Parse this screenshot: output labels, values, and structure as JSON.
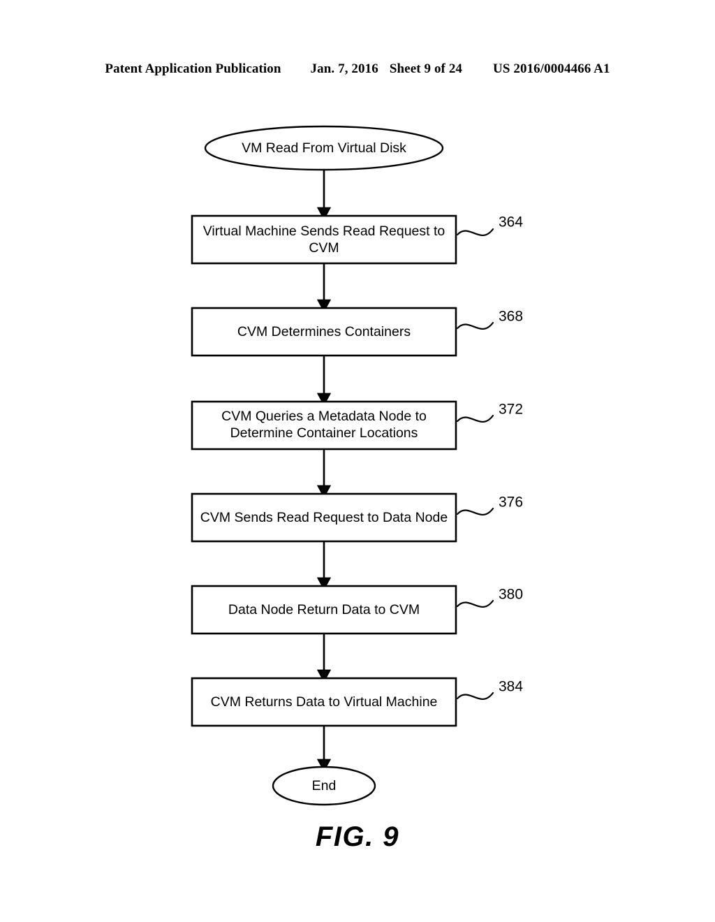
{
  "header": {
    "publication": "Patent Application Publication",
    "date": "Jan. 7, 2016",
    "sheet": "Sheet 9 of 24",
    "patent_number": "US 2016/0004466 A1"
  },
  "figure": {
    "caption": "FIG. 9",
    "start_node": "VM Read From Virtual Disk",
    "end_node": "End"
  },
  "flow": {
    "steps": [
      {
        "ref": "364",
        "line1": "Virtual Machine Sends Read Request to",
        "line2": "CVM"
      },
      {
        "ref": "368",
        "line1": "CVM Determines Containers",
        "line2": ""
      },
      {
        "ref": "372",
        "line1": "CVM Queries a Metadata Node to",
        "line2": "Determine Container Locations"
      },
      {
        "ref": "376",
        "line1": "CVM Sends Read Request to Data Node",
        "line2": ""
      },
      {
        "ref": "380",
        "line1": "Data Node Return Data to CVM",
        "line2": ""
      },
      {
        "ref": "384",
        "line1": "CVM Returns Data to Virtual Machine",
        "line2": ""
      }
    ]
  },
  "colors": {
    "ink": "#000000",
    "paper": "#ffffff"
  }
}
